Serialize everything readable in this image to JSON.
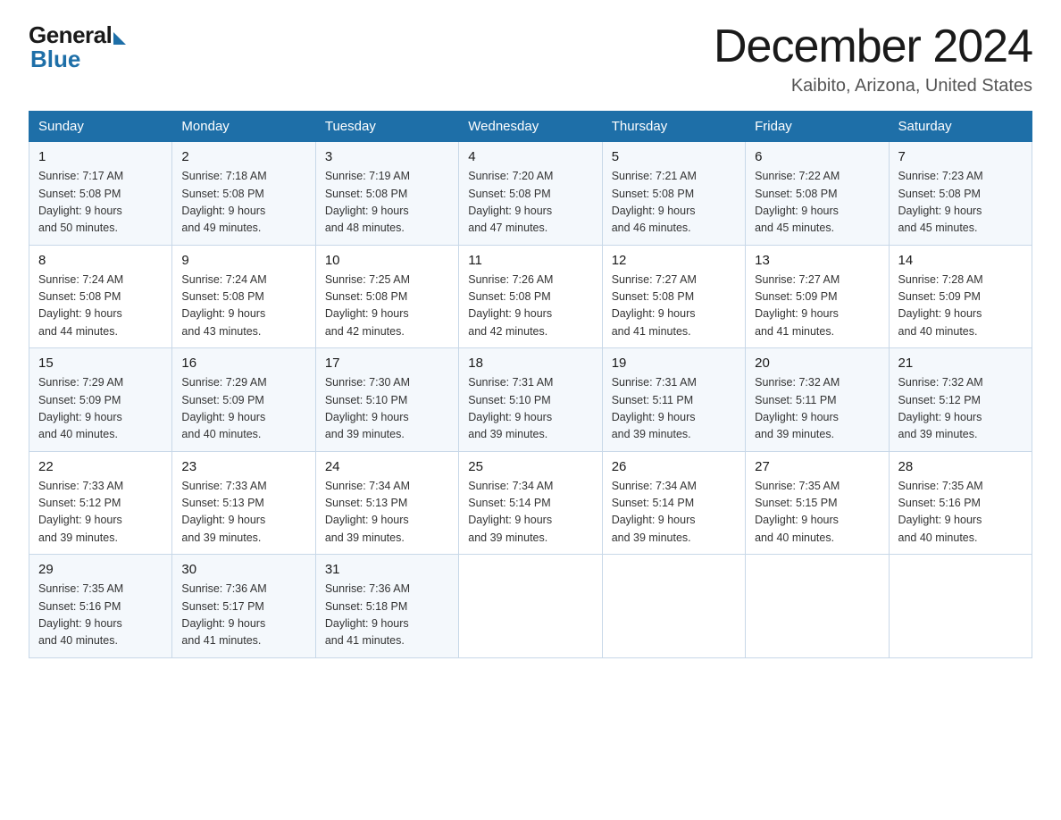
{
  "logo": {
    "general": "General",
    "blue": "Blue"
  },
  "title": "December 2024",
  "location": "Kaibito, Arizona, United States",
  "days_of_week": [
    "Sunday",
    "Monday",
    "Tuesday",
    "Wednesday",
    "Thursday",
    "Friday",
    "Saturday"
  ],
  "weeks": [
    [
      {
        "day": "1",
        "sunrise": "7:17 AM",
        "sunset": "5:08 PM",
        "daylight": "9 hours and 50 minutes."
      },
      {
        "day": "2",
        "sunrise": "7:18 AM",
        "sunset": "5:08 PM",
        "daylight": "9 hours and 49 minutes."
      },
      {
        "day": "3",
        "sunrise": "7:19 AM",
        "sunset": "5:08 PM",
        "daylight": "9 hours and 48 minutes."
      },
      {
        "day": "4",
        "sunrise": "7:20 AM",
        "sunset": "5:08 PM",
        "daylight": "9 hours and 47 minutes."
      },
      {
        "day": "5",
        "sunrise": "7:21 AM",
        "sunset": "5:08 PM",
        "daylight": "9 hours and 46 minutes."
      },
      {
        "day": "6",
        "sunrise": "7:22 AM",
        "sunset": "5:08 PM",
        "daylight": "9 hours and 45 minutes."
      },
      {
        "day": "7",
        "sunrise": "7:23 AM",
        "sunset": "5:08 PM",
        "daylight": "9 hours and 45 minutes."
      }
    ],
    [
      {
        "day": "8",
        "sunrise": "7:24 AM",
        "sunset": "5:08 PM",
        "daylight": "9 hours and 44 minutes."
      },
      {
        "day": "9",
        "sunrise": "7:24 AM",
        "sunset": "5:08 PM",
        "daylight": "9 hours and 43 minutes."
      },
      {
        "day": "10",
        "sunrise": "7:25 AM",
        "sunset": "5:08 PM",
        "daylight": "9 hours and 42 minutes."
      },
      {
        "day": "11",
        "sunrise": "7:26 AM",
        "sunset": "5:08 PM",
        "daylight": "9 hours and 42 minutes."
      },
      {
        "day": "12",
        "sunrise": "7:27 AM",
        "sunset": "5:08 PM",
        "daylight": "9 hours and 41 minutes."
      },
      {
        "day": "13",
        "sunrise": "7:27 AM",
        "sunset": "5:09 PM",
        "daylight": "9 hours and 41 minutes."
      },
      {
        "day": "14",
        "sunrise": "7:28 AM",
        "sunset": "5:09 PM",
        "daylight": "9 hours and 40 minutes."
      }
    ],
    [
      {
        "day": "15",
        "sunrise": "7:29 AM",
        "sunset": "5:09 PM",
        "daylight": "9 hours and 40 minutes."
      },
      {
        "day": "16",
        "sunrise": "7:29 AM",
        "sunset": "5:09 PM",
        "daylight": "9 hours and 40 minutes."
      },
      {
        "day": "17",
        "sunrise": "7:30 AM",
        "sunset": "5:10 PM",
        "daylight": "9 hours and 39 minutes."
      },
      {
        "day": "18",
        "sunrise": "7:31 AM",
        "sunset": "5:10 PM",
        "daylight": "9 hours and 39 minutes."
      },
      {
        "day": "19",
        "sunrise": "7:31 AM",
        "sunset": "5:11 PM",
        "daylight": "9 hours and 39 minutes."
      },
      {
        "day": "20",
        "sunrise": "7:32 AM",
        "sunset": "5:11 PM",
        "daylight": "9 hours and 39 minutes."
      },
      {
        "day": "21",
        "sunrise": "7:32 AM",
        "sunset": "5:12 PM",
        "daylight": "9 hours and 39 minutes."
      }
    ],
    [
      {
        "day": "22",
        "sunrise": "7:33 AM",
        "sunset": "5:12 PM",
        "daylight": "9 hours and 39 minutes."
      },
      {
        "day": "23",
        "sunrise": "7:33 AM",
        "sunset": "5:13 PM",
        "daylight": "9 hours and 39 minutes."
      },
      {
        "day": "24",
        "sunrise": "7:34 AM",
        "sunset": "5:13 PM",
        "daylight": "9 hours and 39 minutes."
      },
      {
        "day": "25",
        "sunrise": "7:34 AM",
        "sunset": "5:14 PM",
        "daylight": "9 hours and 39 minutes."
      },
      {
        "day": "26",
        "sunrise": "7:34 AM",
        "sunset": "5:14 PM",
        "daylight": "9 hours and 39 minutes."
      },
      {
        "day": "27",
        "sunrise": "7:35 AM",
        "sunset": "5:15 PM",
        "daylight": "9 hours and 40 minutes."
      },
      {
        "day": "28",
        "sunrise": "7:35 AM",
        "sunset": "5:16 PM",
        "daylight": "9 hours and 40 minutes."
      }
    ],
    [
      {
        "day": "29",
        "sunrise": "7:35 AM",
        "sunset": "5:16 PM",
        "daylight": "9 hours and 40 minutes."
      },
      {
        "day": "30",
        "sunrise": "7:36 AM",
        "sunset": "5:17 PM",
        "daylight": "9 hours and 41 minutes."
      },
      {
        "day": "31",
        "sunrise": "7:36 AM",
        "sunset": "5:18 PM",
        "daylight": "9 hours and 41 minutes."
      },
      null,
      null,
      null,
      null
    ]
  ],
  "labels": {
    "sunrise": "Sunrise:",
    "sunset": "Sunset:",
    "daylight": "Daylight:"
  }
}
